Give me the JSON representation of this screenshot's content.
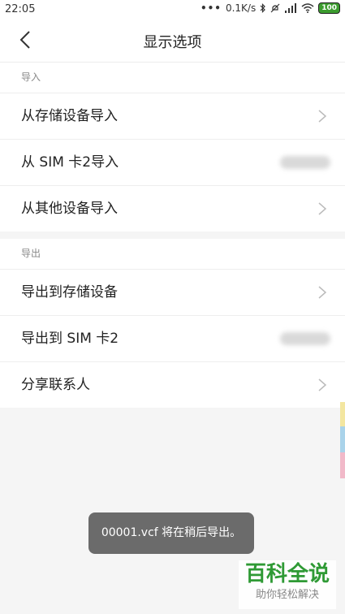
{
  "status_bar": {
    "time": "22:05",
    "dots": "•••",
    "net_speed": "0.1K/s",
    "battery": "100"
  },
  "header": {
    "title": "显示选项"
  },
  "import_section": {
    "label": "导入",
    "items": [
      {
        "label": "从存储设备导入"
      },
      {
        "label": "从 SIM 卡2导入"
      },
      {
        "label": "从其他设备导入"
      }
    ]
  },
  "export_section": {
    "label": "导出",
    "items": [
      {
        "label": "导出到存储设备"
      },
      {
        "label": "导出到 SIM 卡2"
      },
      {
        "label": "分享联系人"
      }
    ]
  },
  "toast": {
    "message": "00001.vcf 将在稍后导出。"
  },
  "watermark": {
    "main": "百科全说",
    "sub": "助你轻松解决"
  },
  "colors": {
    "accent_green": "#2f9a35",
    "edge_yellow": "#f3e6a0",
    "edge_blue": "#a9d3ea",
    "edge_pink": "#f1b9c9"
  }
}
